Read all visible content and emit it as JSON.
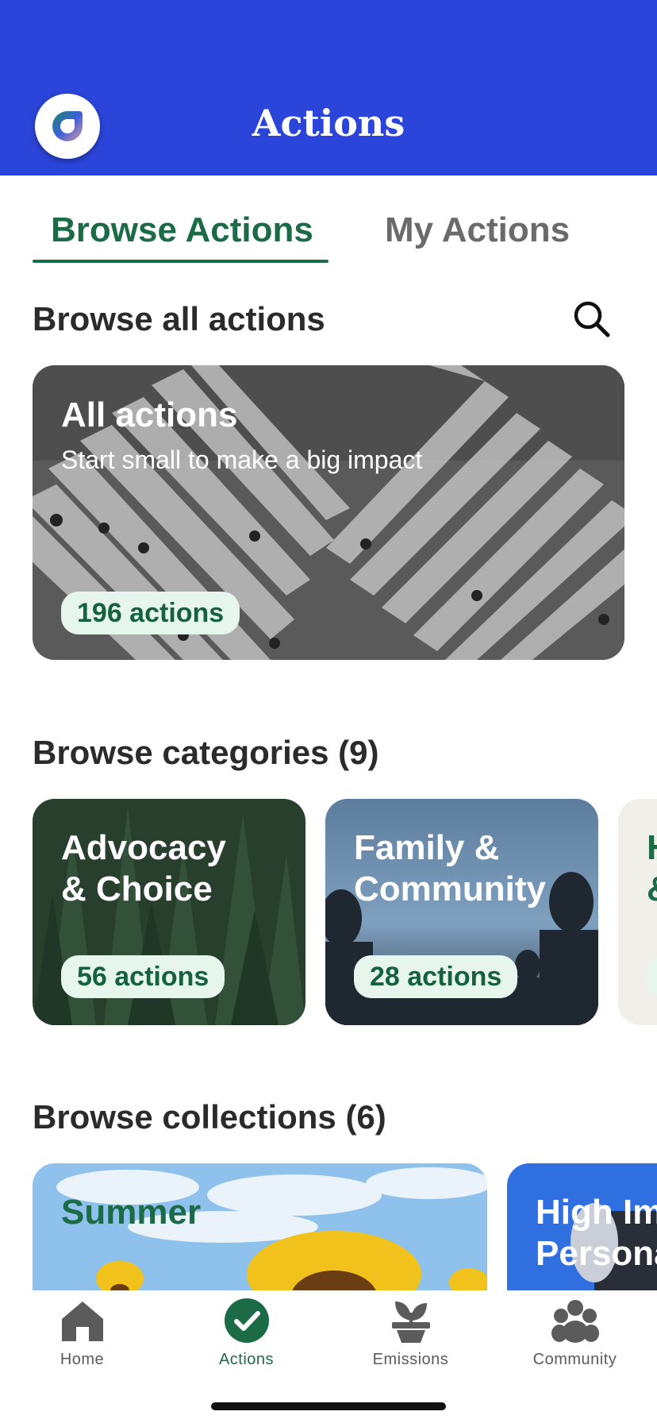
{
  "header": {
    "title": "Actions"
  },
  "tabs": [
    {
      "label": "Browse Actions",
      "active": true
    },
    {
      "label": "My Actions",
      "active": false
    }
  ],
  "browse_all": {
    "title": "Browse all actions",
    "card": {
      "title": "All actions",
      "subtitle": "Start small to make a big impact",
      "count": "196 actions"
    }
  },
  "categories": {
    "title": "Browse categories (9)",
    "items": [
      {
        "title_line1": "Advocacy",
        "title_line2": "& Choice",
        "count": "56 actions"
      },
      {
        "title_line1": "Family &",
        "title_line2": "Community",
        "count": "28 actions"
      },
      {
        "title_line1": "H",
        "title_line2": "&"
      }
    ]
  },
  "collections": {
    "title": "Browse collections (6)",
    "items": [
      {
        "title_line1": "Summer"
      },
      {
        "title_line1": "High Im",
        "title_line2": "Persona"
      }
    ]
  },
  "nav": [
    {
      "label": "Home",
      "icon": "home-icon"
    },
    {
      "label": "Actions",
      "icon": "check-circle-icon",
      "active": true
    },
    {
      "label": "Emissions",
      "icon": "plant-pot-icon"
    },
    {
      "label": "Community",
      "icon": "people-icon"
    }
  ],
  "colors": {
    "brand_blue": "#2b45db",
    "accent_green": "#1c6b47",
    "pill_bg": "#e6f6ec"
  }
}
